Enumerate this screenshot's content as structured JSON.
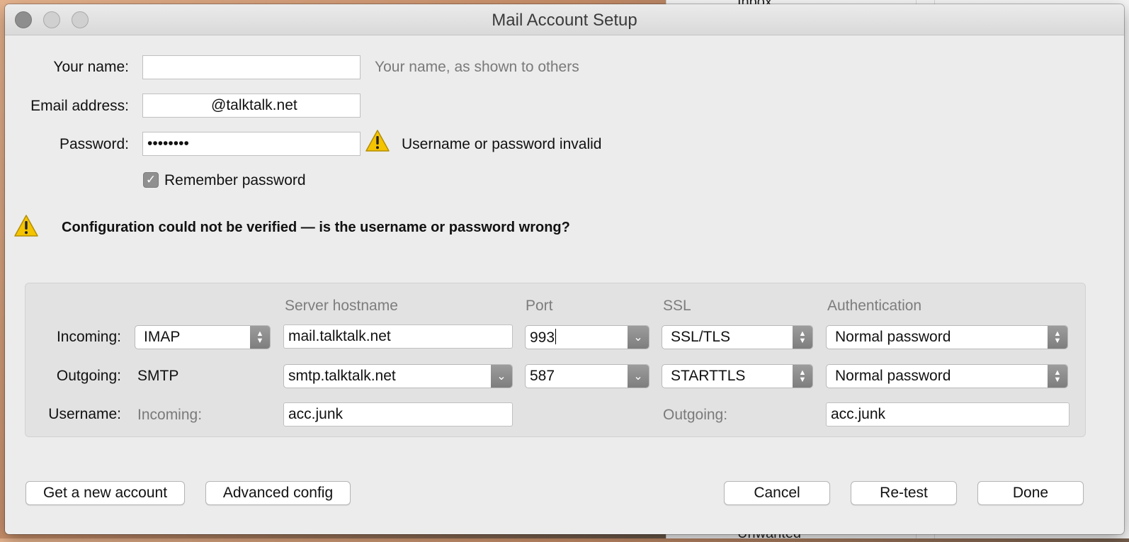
{
  "window": {
    "title": "Mail Account Setup"
  },
  "identity": {
    "name_label": "Your name:",
    "name_value": "",
    "name_hint": "Your name, as shown to others",
    "email_label": "Email address:",
    "email_value": "@talktalk.net",
    "password_label": "Password:",
    "password_value": "••••••••",
    "password_error": "Username or password invalid",
    "remember_label": "Remember password",
    "remember_checked": "✓"
  },
  "status": {
    "message": "Configuration could not be verified — is the username or password wrong?"
  },
  "server": {
    "headers": {
      "hostname": "Server hostname",
      "port": "Port",
      "ssl": "SSL",
      "auth": "Authentication"
    },
    "incoming": {
      "label": "Incoming:",
      "protocol": "IMAP",
      "hostname": "mail.talktalk.net",
      "port": "993",
      "ssl": "SSL/TLS",
      "auth": "Normal password"
    },
    "outgoing": {
      "label": "Outgoing:",
      "protocol": "SMTP",
      "hostname": "smtp.talktalk.net",
      "port": "587",
      "ssl": "STARTTLS",
      "auth": "Normal password"
    },
    "username": {
      "label": "Username:",
      "incoming_label": "Incoming:",
      "incoming_value": "acc.junk",
      "outgoing_label": "Outgoing:",
      "outgoing_value": "acc.junk"
    }
  },
  "buttons": {
    "new_account": "Get a new account",
    "advanced": "Advanced config",
    "cancel": "Cancel",
    "retest": "Re-test",
    "done": "Done"
  },
  "background_window": {
    "top_item": "Inbox",
    "bottom_item": "Unwanted"
  },
  "colors": {
    "warning": "#f5c400",
    "dialog_bg": "#ececec"
  }
}
